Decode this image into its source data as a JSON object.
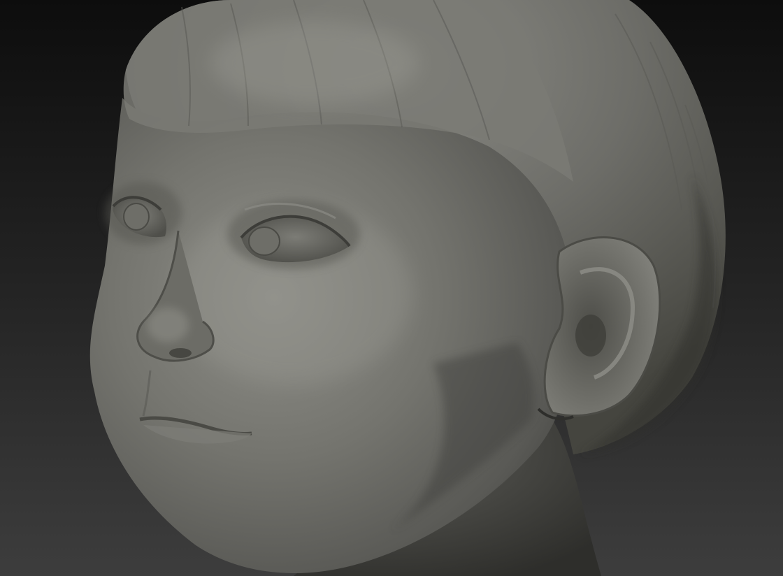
{
  "viewport": {
    "subject": "sculpted-child-head",
    "background_top": "#0f0f0f",
    "background_bottom": "#3a3a3a",
    "clay_light": "#8c8c86",
    "clay_mid": "#6a6a65",
    "clay_dark": "#3c3c39"
  }
}
